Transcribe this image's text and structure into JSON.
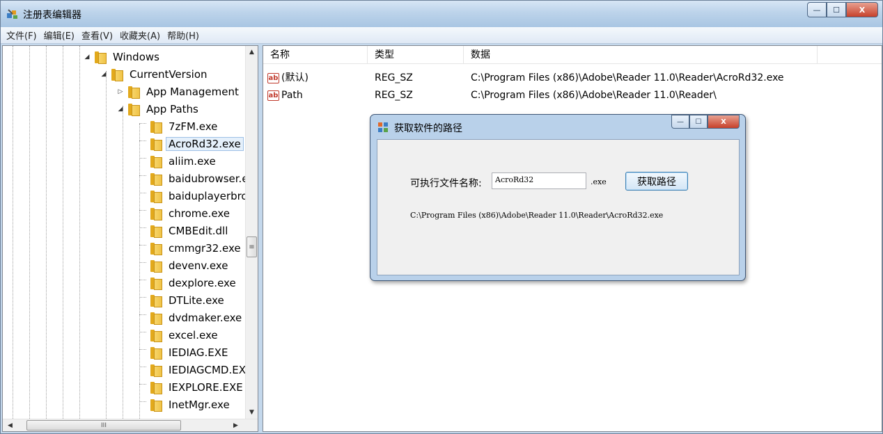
{
  "window": {
    "title": "注册表编辑器",
    "icon": "regedit-icon",
    "caption": {
      "minimize": "—",
      "maximize": "☐",
      "close": "X"
    }
  },
  "menu": [
    "文件(F)",
    "编辑(E)",
    "查看(V)",
    "收藏夹(A)",
    "帮助(H)"
  ],
  "tree": {
    "items": [
      {
        "label": "Windows",
        "expander": "◢",
        "level": 0
      },
      {
        "label": "CurrentVersion",
        "expander": "◢",
        "level": 1
      },
      {
        "label": "App Management",
        "expander": "▷",
        "level": 2
      },
      {
        "label": "App Paths",
        "expander": "◢",
        "level": 2
      },
      {
        "label": "7zFM.exe",
        "expander": "",
        "level": 3
      },
      {
        "label": "AcroRd32.exe",
        "expander": "",
        "level": 3,
        "selected": true
      },
      {
        "label": "aliim.exe",
        "expander": "",
        "level": 3
      },
      {
        "label": "baidubrowser.e",
        "expander": "",
        "level": 3
      },
      {
        "label": "baiduplayerbro",
        "expander": "",
        "level": 3
      },
      {
        "label": "chrome.exe",
        "expander": "",
        "level": 3
      },
      {
        "label": "CMBEdit.dll",
        "expander": "",
        "level": 3
      },
      {
        "label": "cmmgr32.exe",
        "expander": "",
        "level": 3
      },
      {
        "label": "devenv.exe",
        "expander": "",
        "level": 3
      },
      {
        "label": "dexplore.exe",
        "expander": "",
        "level": 3
      },
      {
        "label": "DTLite.exe",
        "expander": "",
        "level": 3
      },
      {
        "label": "dvdmaker.exe",
        "expander": "",
        "level": 3
      },
      {
        "label": "excel.exe",
        "expander": "",
        "level": 3
      },
      {
        "label": "IEDIAG.EXE",
        "expander": "",
        "level": 3
      },
      {
        "label": "IEDIAGCMD.EXE",
        "expander": "",
        "level": 3
      },
      {
        "label": "IEXPLORE.EXE",
        "expander": "",
        "level": 3
      },
      {
        "label": "InetMgr.exe",
        "expander": "",
        "level": 3
      }
    ],
    "vscroll": {
      "up": "▲",
      "down": "▼",
      "thumb": "≡"
    },
    "hscroll": {
      "left": "◀",
      "right": "▶",
      "thumb": "III"
    }
  },
  "list": {
    "columns": [
      "名称",
      "类型",
      "数据"
    ],
    "rows": [
      {
        "icon": "ab",
        "name": "(默认)",
        "type": "REG_SZ",
        "data": "C:\\Program Files (x86)\\Adobe\\Reader 11.0\\Reader\\AcroRd32.exe"
      },
      {
        "icon": "ab",
        "name": "Path",
        "type": "REG_SZ",
        "data": "C:\\Program Files (x86)\\Adobe\\Reader 11.0\\Reader\\"
      }
    ]
  },
  "dialog": {
    "title": "获取软件的路径",
    "caption": {
      "minimize": "—",
      "maximize": "☐",
      "close": "X"
    },
    "label": "可执行文件名称:",
    "input_value": "AcroRd32",
    "ext": ".exe",
    "button": "获取路径",
    "result": "C:\\Program Files (x86)\\Adobe\\Reader 11.0\\Reader\\AcroRd32.exe"
  }
}
